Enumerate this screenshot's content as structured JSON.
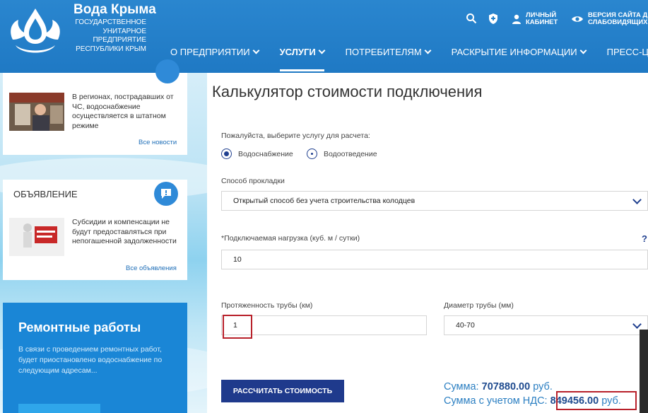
{
  "header": {
    "brand_title": "Вода Крыма",
    "brand_sub": [
      "ГОСУДАРСТВЕННОЕ",
      "УНИТАРНОЕ",
      "ПРЕДПРИЯТИЕ",
      "РЕСПУБЛИКИ КРЫМ"
    ],
    "account_label": [
      "ЛИЧНЫЙ",
      "КАБИНЕТ"
    ],
    "accessibility_label": [
      "ВЕРСИЯ САЙТА Д",
      "СЛАБОВИДЯЩИХ"
    ],
    "nav": [
      {
        "label": "О ПРЕДПРИЯТИИ",
        "active": false
      },
      {
        "label": "УСЛУГИ",
        "active": true
      },
      {
        "label": "ПОТРЕБИТЕЛЯМ",
        "active": false
      },
      {
        "label": "РАСКРЫТИЕ ИНФОРМАЦИИ",
        "active": false
      },
      {
        "label": "ПРЕСС-ЦЕНТ",
        "active": false
      }
    ]
  },
  "sidebar": {
    "news": {
      "text": "В регионах, пострадавших от ЧС, водоснабжение осуществляется в штатном режиме",
      "link": "Все новости"
    },
    "announcement": {
      "title": "ОБЪЯВЛЕНИЕ",
      "text": "Субсидии и компенсации не будут предоставляться при непогашенной задолженности",
      "link": "Все объявления"
    },
    "repair": {
      "title": "Ремонтные работы",
      "text": "В связи с проведением ремонтных работ, будет приостановлено водоснабжение по следующим адресам..."
    }
  },
  "calculator": {
    "title": "Калькулятор стоимости подключения",
    "service_prompt": "Пожалуйста, выберите услугу для расчета:",
    "services": [
      {
        "label": "Водоснабжение",
        "selected": true
      },
      {
        "label": "Водоотведение",
        "selected": false
      }
    ],
    "laying_label": "Способ прокладки",
    "laying_value": "Открытый способ без учета строительства колодцев",
    "load_label": "*Подключаемая нагрузка (куб. м / сутки)",
    "load_value": "10",
    "help_mark": "?",
    "pipe_length_label": "Протяженность трубы (км)",
    "pipe_length_value": "1",
    "diameter_label": "Диаметр трубы (мм)",
    "diameter_value": "40-70",
    "calc_button": "РАССЧИТАТЬ СТОИМОСТЬ",
    "sum_label": "Сумма:",
    "sum_value": "707880.00",
    "sum_currency": "руб.",
    "sum_vat_label": "Сумма с учетом НДС:",
    "sum_vat_value": "849456.00",
    "sum_vat_currency": "руб."
  },
  "colors": {
    "header_blue": "#2280c9",
    "button_navy": "#1f3a8c",
    "highlight_red": "#b8202a"
  }
}
